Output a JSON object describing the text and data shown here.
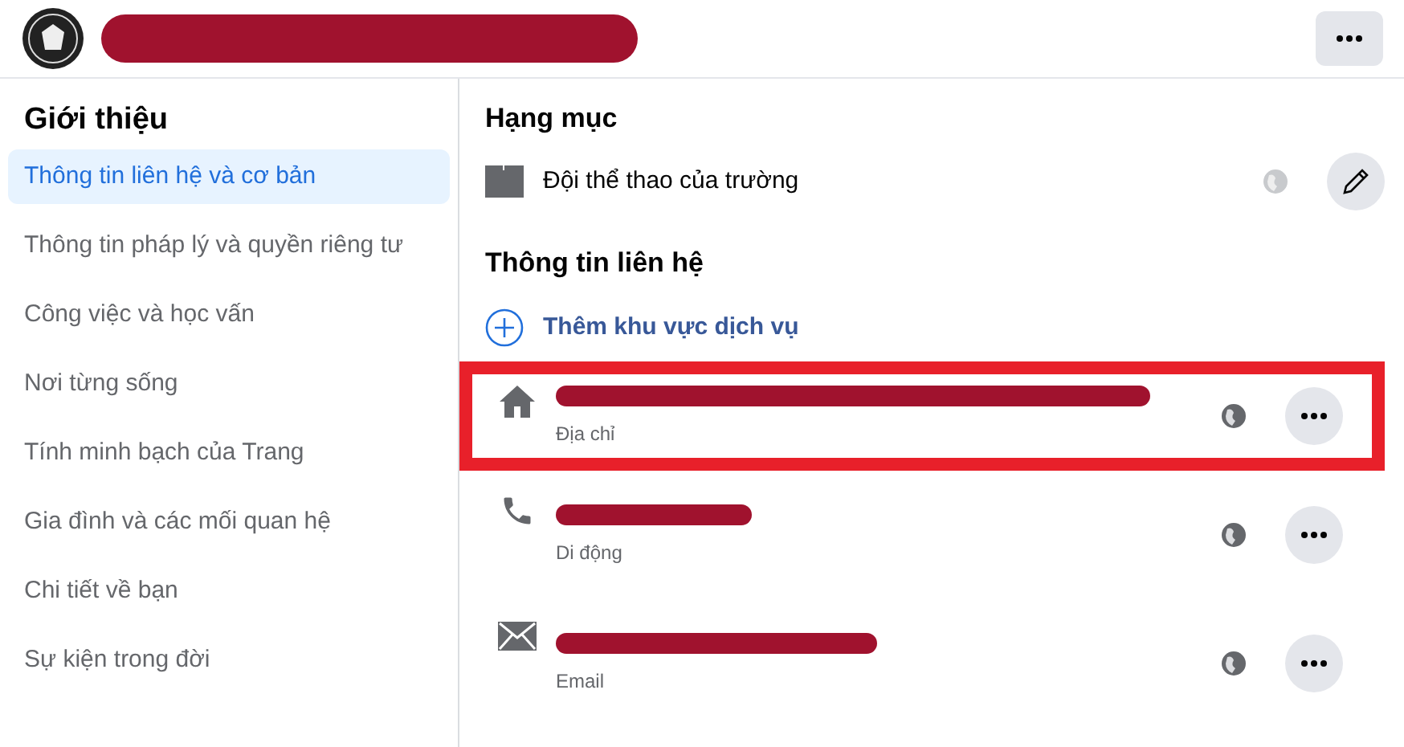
{
  "sidebar": {
    "title": "Giới thiệu",
    "items": [
      {
        "label": "Thông tin liên hệ và cơ bản",
        "selected": true
      },
      {
        "label": "Thông tin pháp lý và quyền riêng tư",
        "selected": false
      },
      {
        "label": "Công việc và học vấn",
        "selected": false
      },
      {
        "label": "Nơi từng sống",
        "selected": false
      },
      {
        "label": "Tính minh bạch của Trang",
        "selected": false
      },
      {
        "label": "Gia đình và các mối quan hệ",
        "selected": false
      },
      {
        "label": "Chi tiết về bạn",
        "selected": false
      },
      {
        "label": "Sự kiện trong đời",
        "selected": false
      }
    ]
  },
  "category": {
    "heading": "Hạng mục",
    "value": "Đội thể thao của trường"
  },
  "contact": {
    "heading": "Thông tin liên hệ",
    "add_link": "Thêm khu vực dịch vụ",
    "rows": [
      {
        "kind": "address",
        "caption": "Địa chỉ",
        "highlighted": true
      },
      {
        "kind": "phone",
        "caption": "Di động",
        "highlighted": false
      },
      {
        "kind": "email",
        "caption": "Email",
        "highlighted": false
      }
    ]
  }
}
